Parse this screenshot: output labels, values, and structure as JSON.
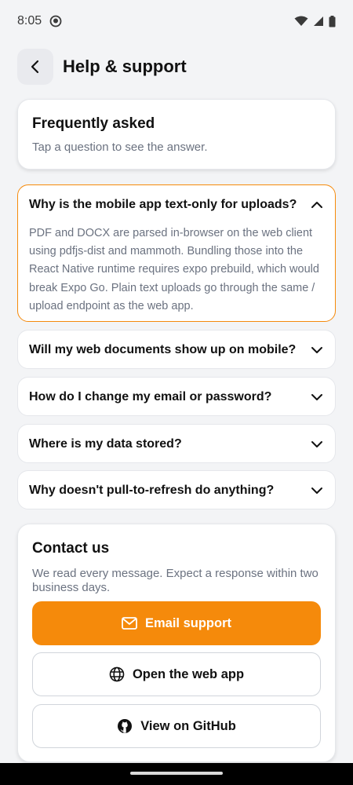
{
  "status": {
    "time": "8:05"
  },
  "header": {
    "title": "Help & support"
  },
  "faq_intro": {
    "title": "Frequently asked",
    "subtitle": "Tap a question to see the answer."
  },
  "faqs": [
    {
      "question": "Why is the mobile app text-only for uploads?",
      "answer": "PDF and DOCX are parsed in-browser on the web client using pdfjs-dist and mammoth. Bundling those into the React Native runtime requires expo prebuild, which would break Expo Go. Plain text uploads go through the same / upload endpoint as the web app.",
      "expanded": true
    },
    {
      "question": "Will my web documents show up on mobile?",
      "expanded": false
    },
    {
      "question": "How do I change my email or password?",
      "expanded": false
    },
    {
      "question": "Where is my data stored?",
      "expanded": false
    },
    {
      "question": "Why doesn't pull-to-refresh do anything?",
      "expanded": false
    }
  ],
  "contact": {
    "title": "Contact us",
    "subtitle": "We read every message. Expect a response within two business days.",
    "email_label": "Email support",
    "web_label": "Open the web app",
    "github_label": "View on GitHub"
  },
  "colors": {
    "accent": "#f58a0b",
    "background": "#f3f4f6",
    "muted_text": "#6b7280"
  },
  "icons": {
    "back": "arrow-left-icon",
    "chevron_up": "chevron-up-icon",
    "chevron_down": "chevron-down-icon",
    "email": "mail-icon",
    "web": "globe-icon",
    "github": "github-icon"
  }
}
